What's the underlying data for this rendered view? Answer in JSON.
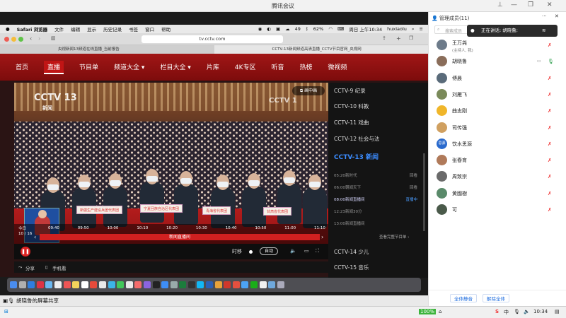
{
  "meeting": {
    "title": "腾讯会议"
  },
  "mac": {
    "menubar": [
      "Safari 浏览器",
      "文件",
      "编辑",
      "显示",
      "历史记录",
      "书签",
      "窗口",
      "帮助"
    ],
    "right": {
      "battery_num": "49",
      "battery_pct": "62%",
      "datetime": "周日 上午10:34",
      "user": "huxiaolu"
    }
  },
  "safari": {
    "url": "tv.cctv.com",
    "tabs": [
      "央视新闻13频道在线直播_当前报告",
      "CCTV-13新闻频道高清直播_CCTV节目官网_央视网"
    ]
  },
  "cctv": {
    "nav": [
      "首页",
      "直播",
      "节目单",
      "频道大全 ▾",
      "栏目大全 ▾",
      "片库",
      "4K专区",
      "听音",
      "热榜",
      "微视频"
    ],
    "pip": "画中画",
    "logo": "CCTV 13",
    "logo_sub": "新闻",
    "logo2": "CCTV 1",
    "timeline": {
      "date_top": "今日",
      "date": "10 / 16",
      "ticks": [
        "09:40",
        "09:50",
        "10:00",
        "10:10",
        "10:20",
        "10:30",
        "10:40",
        "10:50",
        "11:00",
        "11:10"
      ],
      "current_program": "新闻直播间"
    },
    "controls": {
      "shift": "时移",
      "auto": "自动"
    },
    "share": {
      "share": "分享",
      "mobile": "手机看"
    },
    "placards": [
      "新疆生产建设兵团代表团",
      "宁夏回族自治区代表团",
      "青海省代表团",
      "甘肃省代表团"
    ],
    "channels": [
      {
        "name": "CCTV-9 纪录"
      },
      {
        "name": "CCTV-10 科教"
      },
      {
        "name": "CCTV-11 戏曲"
      },
      {
        "name": "CCTV-12 社会与法"
      },
      {
        "name": "CCTV-13 新闻"
      }
    ],
    "programs": [
      {
        "time": "05:20",
        "title": "新时代",
        "status": "回看"
      },
      {
        "time": "06:00",
        "title": "朝闻天下",
        "status": "回看"
      },
      {
        "time": "08:00",
        "title": "新闻直播间",
        "status": "直播中"
      },
      {
        "time": "12:23",
        "title": "新闻30分",
        "status": ""
      },
      {
        "time": "13:00",
        "title": "新闻直播间",
        "status": ""
      }
    ],
    "full_schedule": "查看完整节目单 ›",
    "channels_after": [
      {
        "name": "CCTV-14 少儿"
      },
      {
        "name": "CCTV-15 音乐"
      }
    ]
  },
  "windows": {
    "screen_share": "胡晓鲁的屏幕共享",
    "time": "10:34",
    "battery": "100%",
    "ime": "中"
  },
  "members_panel": {
    "header": "管理成员(11)",
    "search_placeholder": "搜索成员",
    "speaking": "正在讲话: 胡晓鲁;",
    "members": [
      {
        "name": "王万尧",
        "role": "(主持人, 我)",
        "avatar": "",
        "color": "#6d7b8a"
      },
      {
        "name": "胡晓鲁",
        "role": "",
        "avatar": "",
        "color": "#8a6d5a"
      },
      {
        "name": "傅晨",
        "role": "",
        "avatar": "",
        "color": "#5a6b7a"
      },
      {
        "name": "刘雁飞",
        "role": "",
        "avatar": "",
        "color": "#7a8a5a"
      },
      {
        "name": "曲志刚",
        "role": "",
        "avatar": "",
        "color": "#f0b62a"
      },
      {
        "name": "司传强",
        "role": "",
        "avatar": "",
        "color": "#d0a060"
      },
      {
        "name": "饮水思源",
        "role": "",
        "avatar": "思源",
        "color": "#2a6acd"
      },
      {
        "name": "张春育",
        "role": "",
        "avatar": "",
        "color": "#b07a5a"
      },
      {
        "name": "周致宗",
        "role": "",
        "avatar": "",
        "color": "#6a6a6a"
      },
      {
        "name": "黄國樹",
        "role": "",
        "avatar": "",
        "color": "#5a8a6a"
      },
      {
        "name": "可",
        "role": "",
        "avatar": "",
        "color": "#4a5a4a"
      }
    ],
    "mute_all": "全体静音",
    "unmute_all": "解除全体"
  }
}
